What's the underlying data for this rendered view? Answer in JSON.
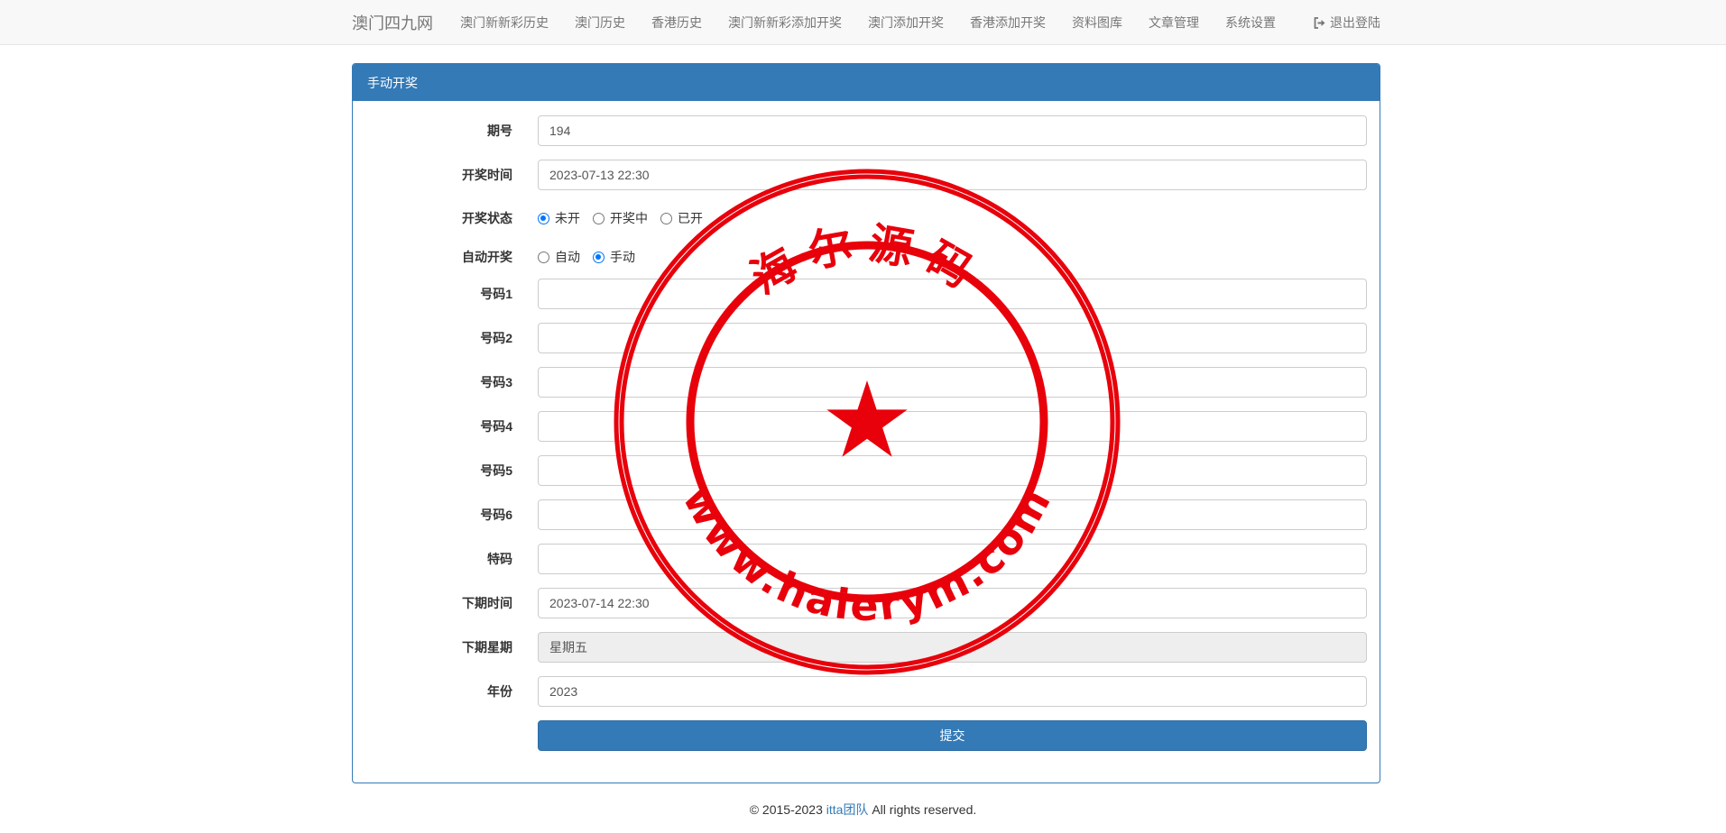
{
  "navbar": {
    "brand": "澳门四九网",
    "links": [
      "澳门新新彩历史",
      "澳门历史",
      "香港历史",
      "澳门新新彩添加开奖",
      "澳门添加开奖",
      "香港添加开奖",
      "资料图库",
      "文章管理",
      "系统设置"
    ],
    "logout": "退出登陆"
  },
  "panel": {
    "title": "手动开奖",
    "fields": {
      "issue": {
        "label": "期号",
        "value": "194"
      },
      "draw_time": {
        "label": "开奖时间",
        "value": "2023-07-13 22:30"
      },
      "draw_status": {
        "label": "开奖状态",
        "options": [
          "未开",
          "开奖中",
          "已开"
        ],
        "selected": "未开"
      },
      "auto_draw": {
        "label": "自动开奖",
        "options": [
          "自动",
          "手动"
        ],
        "selected": "手动"
      },
      "num1": {
        "label": "号码1",
        "value": ""
      },
      "num2": {
        "label": "号码2",
        "value": ""
      },
      "num3": {
        "label": "号码3",
        "value": ""
      },
      "num4": {
        "label": "号码4",
        "value": ""
      },
      "num5": {
        "label": "号码5",
        "value": ""
      },
      "num6": {
        "label": "号码6",
        "value": ""
      },
      "special": {
        "label": "特码",
        "value": ""
      },
      "next_time": {
        "label": "下期时间",
        "value": "2023-07-14 22:30"
      },
      "next_weekday": {
        "label": "下期星期",
        "value": "星期五"
      },
      "year": {
        "label": "年份",
        "value": "2023"
      }
    },
    "submit_label": "提交"
  },
  "footer": {
    "prefix": "© 2015-2023 ",
    "link": "itta团队",
    "suffix": " All rights reserved."
  },
  "watermark": {
    "top_text": "海尔源码",
    "bottom_text": "www.haierym.com",
    "color": "#e8000b"
  },
  "colors": {
    "primary": "#337ab7",
    "radio": "#0075ff"
  }
}
